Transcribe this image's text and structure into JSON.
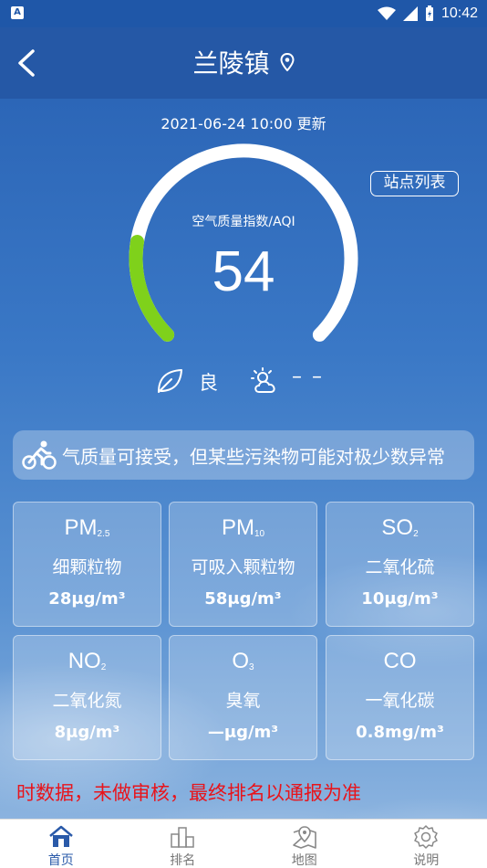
{
  "status_bar": {
    "time": "10:42",
    "notification_letter": "A"
  },
  "header": {
    "title": "兰陵镇"
  },
  "updated": "2021-06-24 10:00 更新",
  "aqi": {
    "label": "空气质量指数/AQI",
    "value": "54",
    "level": "良",
    "gauge_fraction": 0.2,
    "gauge_color": "#7fd11b"
  },
  "station_button": "站点列表",
  "weather": {
    "text": "– –"
  },
  "advice": "气质量可接受，但某些污染物可能对极少数异常",
  "pollutants": [
    {
      "symbol": "PM",
      "sub": "2.5",
      "name": "细颗粒物",
      "value": "28μg/m³"
    },
    {
      "symbol": "PM",
      "sub": "10",
      "name": "可吸入颗粒物",
      "value": "58μg/m³"
    },
    {
      "symbol": "SO",
      "sub": "2",
      "name": "二氧化硫",
      "value": "10μg/m³"
    },
    {
      "symbol": "NO",
      "sub": "2",
      "name": "二氧化氮",
      "value": "8μg/m³"
    },
    {
      "symbol": "O",
      "sub": "3",
      "name": "臭氧",
      "value": "—μg/m³"
    },
    {
      "symbol": "CO",
      "sub": "",
      "name": "一氧化碳",
      "value": "0.8mg/m³"
    }
  ],
  "warning": "时数据，未做审核，最终排名以通报为准",
  "tabs": [
    {
      "label": "首页",
      "icon": "home-icon",
      "active": true
    },
    {
      "label": "排名",
      "icon": "podium-icon",
      "active": false
    },
    {
      "label": "地图",
      "icon": "map-icon",
      "active": false
    },
    {
      "label": "说明",
      "icon": "gear-icon",
      "active": false
    }
  ],
  "colors": {
    "header": "#2558a6",
    "tab_active": "#2a5aa9",
    "warning": "#e8141b"
  }
}
